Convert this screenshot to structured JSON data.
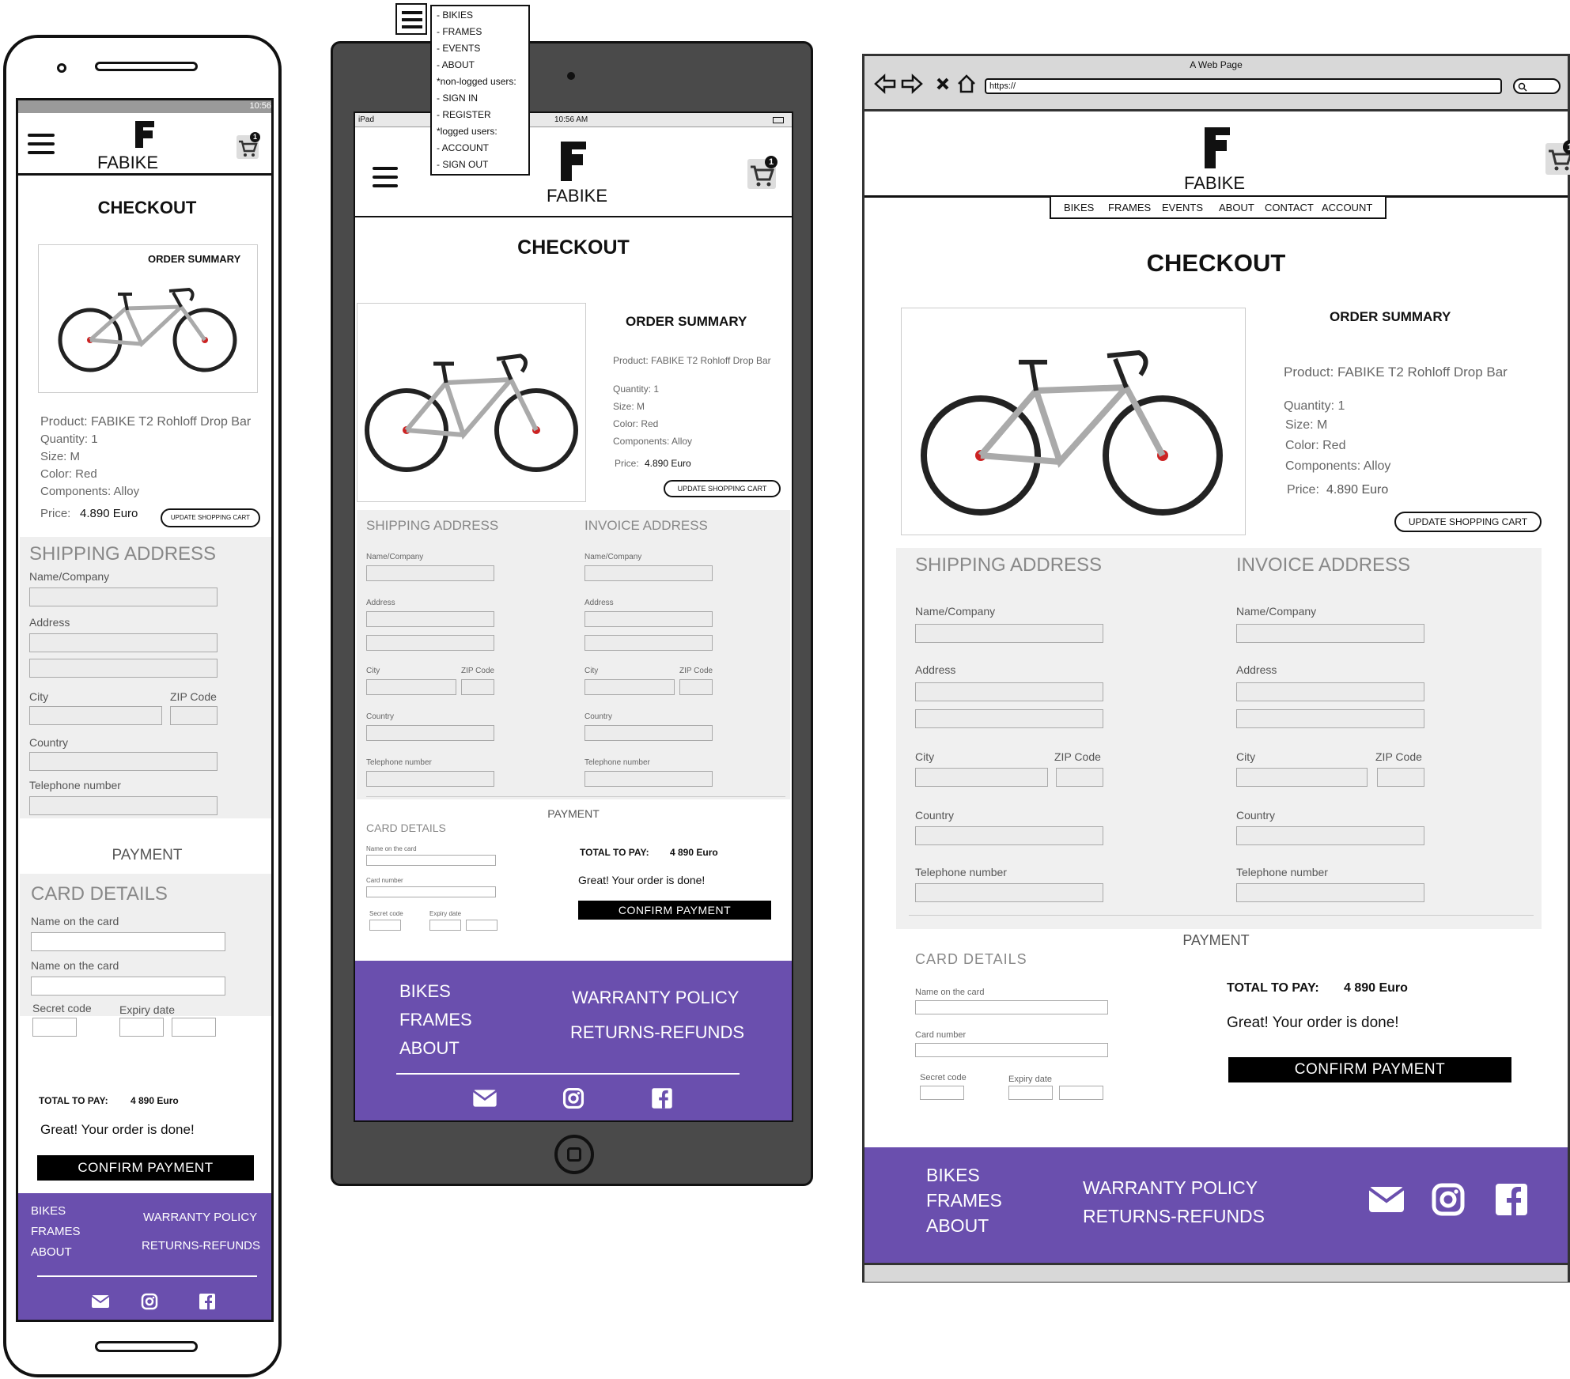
{
  "brand": {
    "name": "FABIKE"
  },
  "checkout": {
    "title": "CHECKOUT",
    "order_summary_title": "ORDER SUMMARY",
    "product": "Product: FABIKE T2 Rohloff Drop Bar",
    "quantity": "Quantity: 1",
    "size": "Size: M",
    "color": "Color: Red",
    "components": "Components: Alloy",
    "price_label": "Price:",
    "price_value": "4.890 Euro",
    "update_cart": "UPDATE SHOPPING CART",
    "cart_count": "1"
  },
  "shipping": {
    "title": "SHIPPING ADDRESS",
    "name_company": "Name/Company",
    "address": "Address",
    "city": "City",
    "zip": "ZIP Code",
    "country": "Country",
    "telephone": "Telephone number"
  },
  "invoice": {
    "title": "INVOICE ADDRESS",
    "name_company": "Name/Company",
    "address": "Address",
    "city": "City",
    "zip": "ZIP Code",
    "country": "Country",
    "telephone": "Telephone number"
  },
  "payment": {
    "title": "PAYMENT",
    "card_details": "CARD DETAILS",
    "name_on_card": "Name on the card",
    "card_number": "Card number",
    "secret_code": "Secret code",
    "expiry_date": "Expiry date",
    "total_label": "TOTAL TO PAY:",
    "total_value": "4 890 Euro",
    "success": "Great! Your order is done!",
    "confirm": "CONFIRM PAYMENT"
  },
  "footer": {
    "bikes": "BIKES",
    "frames": "FRAMES",
    "about": "ABOUT",
    "warranty": "WARRANTY POLICY",
    "returns": "RETURNS-REFUNDS",
    "icons": [
      "envelope-icon",
      "instagram-icon",
      "facebook-icon"
    ]
  },
  "nav": {
    "bikes": "BIKES",
    "frames": "FRAMES",
    "events": "EVENTS",
    "about": "ABOUT",
    "contact": "CONTACT",
    "account": "ACCOUNT"
  },
  "dropdown_menu": {
    "items": [
      "- BIKIES",
      "- FRAMES",
      "- EVENTS",
      "- ABOUT",
      "*non-logged users:",
      "- SIGN IN",
      "- REGISTER",
      "*logged users:",
      "- ACCOUNT",
      "- SIGN OUT"
    ]
  },
  "phone_status": {
    "time": "10:56"
  },
  "tablet_status": {
    "carrier": "iPad",
    "time": "10:56 AM"
  },
  "browser": {
    "title": "A Web Page",
    "url": "https://"
  },
  "colors": {
    "footer": "#6a4fae",
    "accent": "#000000"
  }
}
